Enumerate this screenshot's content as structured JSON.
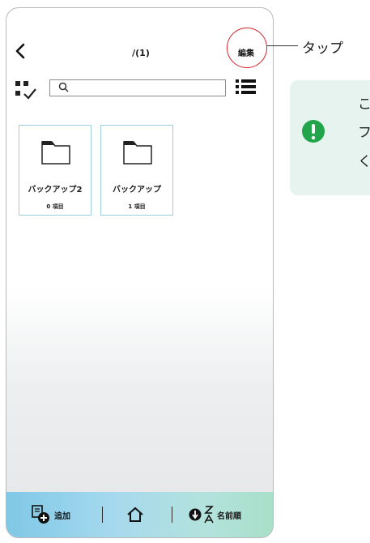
{
  "header": {
    "back_icon": "chevron-left-icon",
    "title": "/(1)",
    "edit_label": "編集"
  },
  "toolbar": {
    "select_icon": "multi-select-check-icon",
    "search": {
      "icon": "search-icon",
      "value": "",
      "placeholder": ""
    },
    "view_icon": "list-view-icon"
  },
  "folders": [
    {
      "name": "バックアップ2",
      "count": "0 項目",
      "icon": "folder-icon"
    },
    {
      "name": "バックアップ",
      "count": "1 項目",
      "icon": "folder-icon"
    }
  ],
  "bottom_bar": {
    "add_label": "追加",
    "add_icon": "add-file-icon",
    "home_icon": "home-icon",
    "sort_icon": "sort-down-icon",
    "sort_az_icon": "sort-z-a-icon",
    "sort_label": "名前順"
  },
  "annotation": {
    "tap_label": "タップ",
    "highlight_color": "#d2232a",
    "note_icon": "exclamation-icon",
    "note_lines": [
      "こ",
      "フ",
      "く"
    ]
  },
  "colors": {
    "folder_border": "#9fd0e0",
    "bottom_bar_start": "#7fc8e6",
    "bottom_bar_end": "#a8e0c9",
    "note_bg": "#e6f3ee",
    "note_icon": "#21a44a"
  }
}
